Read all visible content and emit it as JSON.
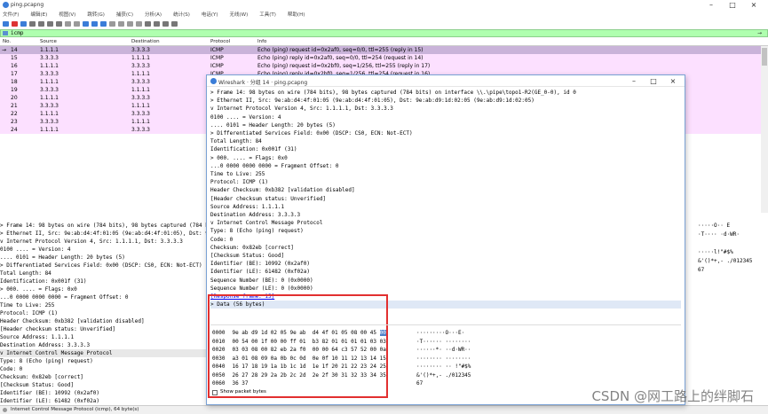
{
  "window": {
    "title": "ping.pcapng"
  },
  "menu": [
    "文件(F)",
    "编辑(E)",
    "视图(V)",
    "跳转(G)",
    "捕获(C)",
    "分析(A)",
    "统计(S)",
    "电话(Y)",
    "无线(W)",
    "工具(T)",
    "帮助(H)"
  ],
  "filter": {
    "text": "icmp",
    "arrow": "→"
  },
  "packet_list": {
    "columns": [
      "No.",
      "Source",
      "Destination",
      "Protocol",
      "Info"
    ],
    "rows": [
      {
        "no": "14",
        "src": "1.1.1.1",
        "dst": "3.3.3.3",
        "proto": "ICMP",
        "info": "Echo (ping) request  id=0x2af0, seq=0/0, ttl=255 (reply in 15)",
        "kind": "sel"
      },
      {
        "no": "15",
        "src": "3.3.3.3",
        "dst": "1.1.1.1",
        "proto": "ICMP",
        "info": "Echo (ping) reply    id=0x2af0, seq=0/0, ttl=254 (request in 14)",
        "kind": "rep"
      },
      {
        "no": "16",
        "src": "1.1.1.1",
        "dst": "3.3.3.3",
        "proto": "ICMP",
        "info": "Echo (ping) request  id=0x2bf0, seq=1/256, ttl=255 (reply in 17)",
        "kind": "req"
      },
      {
        "no": "17",
        "src": "3.3.3.3",
        "dst": "1.1.1.1",
        "proto": "ICMP",
        "info": "Echo (ping) reply    id=0x2bf0, seq=1/256, ttl=254 (request in 16)",
        "kind": "rep"
      },
      {
        "no": "18",
        "src": "1.1.1.1",
        "dst": "3.3.3.3",
        "proto": "ICMP",
        "info": "",
        "kind": "req"
      },
      {
        "no": "19",
        "src": "3.3.3.3",
        "dst": "1.1.1.1",
        "proto": "",
        "info": "",
        "kind": "rep"
      },
      {
        "no": "20",
        "src": "1.1.1.1",
        "dst": "3.3.3.3",
        "proto": "",
        "info": "",
        "kind": "req"
      },
      {
        "no": "21",
        "src": "3.3.3.3",
        "dst": "1.1.1.1",
        "proto": "",
        "info": "",
        "kind": "rep"
      },
      {
        "no": "22",
        "src": "1.1.1.1",
        "dst": "3.3.3.3",
        "proto": "",
        "info": "",
        "kind": "req"
      },
      {
        "no": "23",
        "src": "3.3.3.3",
        "dst": "1.1.1.1",
        "proto": "",
        "info": "",
        "kind": "rep"
      },
      {
        "no": "24",
        "src": "1.1.1.1",
        "dst": "3.3.3.3",
        "proto": "",
        "info": "",
        "kind": "req"
      }
    ]
  },
  "details": [
    {
      "text": "> Frame 14: 98 bytes on wire (784 bits), 98 bytes captured (784 bits) on",
      "style": ""
    },
    {
      "text": "> Ethernet II, Src: 9e:ab:d4:4f:01:05 (9e:ab:d4:4f:01:05), Dst: 9e:ab:d9:1",
      "style": ""
    },
    {
      "text": "v Internet Protocol Version 4, Src: 1.1.1.1, Dst: 3.3.3.3",
      "style": ""
    },
    {
      "text": "    0100 .... = Version: 4",
      "style": ""
    },
    {
      "text": "    .... 0101 = Header Length: 20 bytes (5)",
      "style": ""
    },
    {
      "text": "  > Differentiated Services Field: 0x00 (DSCP: CS0, ECN: Not-ECT)",
      "style": ""
    },
    {
      "text": "    Total Length: 84",
      "style": ""
    },
    {
      "text": "    Identification: 0x001f (31)",
      "style": ""
    },
    {
      "text": "  > 000. .... = Flags: 0x0",
      "style": ""
    },
    {
      "text": "    ...0 0000 0000 0000 = Fragment Offset: 0",
      "style": ""
    },
    {
      "text": "    Time to Live: 255",
      "style": ""
    },
    {
      "text": "    Protocol: ICMP (1)",
      "style": ""
    },
    {
      "text": "    Header Checksum: 0xb382 [validation disabled]",
      "style": ""
    },
    {
      "text": "    [Header checksum status: Unverified]",
      "style": ""
    },
    {
      "text": "    Source Address: 1.1.1.1",
      "style": ""
    },
    {
      "text": "    Destination Address: 3.3.3.3",
      "style": ""
    },
    {
      "text": "v Internet Control Message Protocol",
      "style": "hl"
    },
    {
      "text": "    Type: 8 (Echo (ping) request)",
      "style": ""
    },
    {
      "text": "    Code: 0",
      "style": ""
    },
    {
      "text": "    Checksum: 0x82eb [correct]",
      "style": ""
    },
    {
      "text": "    [Checksum Status: Good]",
      "style": ""
    },
    {
      "text": "    Identifier (BE): 10992 (0x2af0)",
      "style": ""
    },
    {
      "text": "    Identifier (LE): 61482 (0xf02a)",
      "style": ""
    }
  ],
  "bytes_right": [
    "·····O·· E",
    "·T···· ·d·WR·",
    "",
    "·····l!\"#$%",
    "&'()*+,- ./012345",
    "67"
  ],
  "popup": {
    "title": "Wireshark · 分组 14 · ping.pcapng",
    "tree": [
      {
        "text": "> Frame 14: 98 bytes on wire (784 bits), 98 bytes captured (784 bits) on interface \\\\.\\pipe\\topo1-R2(GE_0-0), id 0",
        "sel": false
      },
      {
        "text": "> Ethernet II, Src: 9e:ab:d4:4f:01:05 (9e:ab:d4:4f:01:05), Dst: 9e:ab:d9:1d:02:05 (9e:ab:d9:1d:02:05)",
        "sel": false
      },
      {
        "text": "v Internet Protocol Version 4, Src: 1.1.1.1, Dst: 3.3.3.3",
        "sel": false
      },
      {
        "text": "    0100 .... = Version: 4",
        "sel": false
      },
      {
        "text": "    .... 0101 = Header Length: 20 bytes (5)",
        "sel": false
      },
      {
        "text": "  > Differentiated Services Field: 0x00 (DSCP: CS0, ECN: Not-ECT)",
        "sel": false
      },
      {
        "text": "    Total Length: 84",
        "sel": false
      },
      {
        "text": "    Identification: 0x001f (31)",
        "sel": false
      },
      {
        "text": "  > 000. .... = Flags: 0x0",
        "sel": false
      },
      {
        "text": "    ...0 0000 0000 0000 = Fragment Offset: 0",
        "sel": false
      },
      {
        "text": "    Time to Live: 255",
        "sel": false
      },
      {
        "text": "    Protocol: ICMP (1)",
        "sel": false
      },
      {
        "text": "    Header Checksum: 0xb382 [validation disabled]",
        "sel": false
      },
      {
        "text": "    [Header checksum status: Unverified]",
        "sel": false
      },
      {
        "text": "    Source Address: 1.1.1.1",
        "sel": false
      },
      {
        "text": "    Destination Address: 3.3.3.3",
        "sel": false
      },
      {
        "text": "v Internet Control Message Protocol",
        "sel": false
      },
      {
        "text": "    Type: 8 (Echo (ping) request)",
        "sel": false
      },
      {
        "text": "    Code: 0",
        "sel": false
      },
      {
        "text": "    Checksum: 0x82eb [correct]",
        "sel": false
      },
      {
        "text": "    [Checksum Status: Good]",
        "sel": false
      },
      {
        "text": "    Identifier (BE): 10992 (0x2af0)",
        "sel": false
      },
      {
        "text": "    Identifier (LE): 61482 (0xf02a)",
        "sel": false
      },
      {
        "text": "    Sequence Number (BE): 0 (0x0000)",
        "sel": false
      },
      {
        "text": "    Sequence Number (LE): 0 (0x0000)",
        "sel": false
      },
      {
        "text": "    [Response frame: 15]",
        "sel": false,
        "link": true
      },
      {
        "text": "  > Data (56 bytes)",
        "sel": true
      }
    ],
    "hex": [
      {
        "off": "0000",
        "bytes": "9e ab d9 1d 02 05 9e ab  d4 4f 01 05 08 00 45 ",
        "sel": "00",
        "ascii": "·········O···E·"
      },
      {
        "off": "0010",
        "bytes": "00 54 00 1f 00 00 ff 01  b3 82 01 01 01 01 03 03",
        "sel": "",
        "ascii": "·T······ ········"
      },
      {
        "off": "0020",
        "bytes": "03 03 08 00 82 eb 2a f0  00 00 64 c3 57 52 00 0a",
        "sel": "",
        "ascii": "······*· ··d·WR··"
      },
      {
        "off": "0030",
        "bytes": "a3 01 08 09 0a 0b 0c 0d  0e 0f 10 11 12 13 14 15",
        "sel": "",
        "ascii": "········ ········"
      },
      {
        "off": "0040",
        "bytes": "16 17 18 19 1a 1b 1c 1d  1e 1f 20 21 22 23 24 25",
        "sel": "",
        "ascii": "········ ·· !\"#$%"
      },
      {
        "off": "0050",
        "bytes": "26 27 28 29 2a 2b 2c 2d  2e 2f 30 31 32 33 34 35",
        "sel": "",
        "ascii": "&'()*+,- ./012345"
      },
      {
        "off": "0060",
        "bytes": "36 37",
        "sel": "",
        "ascii": "67"
      }
    ],
    "show_bytes_label": "Show packet bytes"
  },
  "status": {
    "text": "Internet Control Message Protocol (icmp), 64 byte(s)"
  },
  "watermark": "CSDN @网工路上的绊脚石",
  "colors": {
    "filter_bg": "#afffaf",
    "row_icmp": "#fce0ff",
    "row_selected": "#c9b3d9",
    "highlight_box": "#e23030",
    "hex_selected": "#4d80c8"
  }
}
